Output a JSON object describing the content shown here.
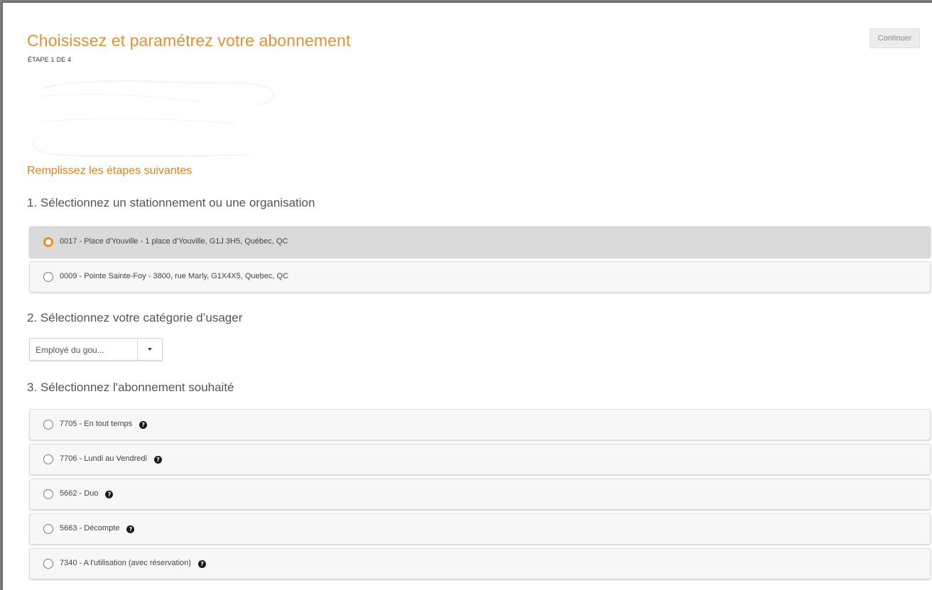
{
  "header": {
    "title": "Choisissez et paramétrez votre abonnement",
    "step": "ÉTAPE 1 DE 4",
    "continue_label": "Continuer"
  },
  "subtitle": "Remplissez les étapes suivantes",
  "section1": {
    "heading": "1. Sélectionnez un stationnement ou une organisation",
    "options": [
      {
        "label": "0017 - Place d'Youville - 1 place d'Youville, G1J 3H5, Québec, QC",
        "selected": true
      },
      {
        "label": "0009 - Pointe Sainte-Foy - 3800, rue Marly, G1X4X5, Quebec, QC",
        "selected": false
      }
    ]
  },
  "section2": {
    "heading": "2. Sélectionnez votre catégorie d’usager",
    "select_value": "Employé du gou..."
  },
  "section3": {
    "heading": "3. Sélectionnez l'abonnement souhaité",
    "options": [
      {
        "label": "7705 - En tout temps",
        "selected": false
      },
      {
        "label": "7706 - Lundi au Vendredi",
        "selected": false
      },
      {
        "label": "5662 - Duo",
        "selected": false
      },
      {
        "label": "5663 - Décompte",
        "selected": false
      },
      {
        "label": "7340 - A l'utilisation (avec réservation)",
        "selected": false
      }
    ]
  },
  "icons": {
    "info": "question-circle-icon",
    "radio_checked": "radio-checked-icon",
    "select_caret": "caret-down-icon"
  },
  "colors": {
    "accent": "#e0913a",
    "radio_selected": "#ef8c1e",
    "selected_row_bg": "#dadada",
    "row_bg": "#f7f7f7"
  }
}
